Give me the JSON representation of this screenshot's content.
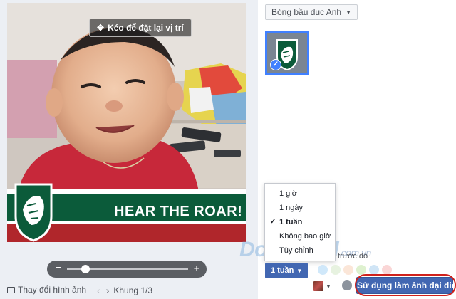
{
  "editor": {
    "drag_hint": "Kéo để đặt lại vị trí",
    "banner_text": "HEAR THE ROAR!",
    "zoom": {
      "level": 0.15,
      "minus_icon": "minus-icon",
      "plus_icon": "plus-icon"
    },
    "change_photo_label": "Thay đổi hình ảnh",
    "frame_counter": "Khung 1/3"
  },
  "frame_picker": {
    "selected_label": "Bóng bầu dục Anh",
    "thumbnail_icon": "leicester-tigers-logo",
    "thumbnail_selected": true
  },
  "duration": {
    "options": [
      {
        "label": "1 giờ",
        "selected": false
      },
      {
        "label": "1 ngày",
        "selected": false
      },
      {
        "label": "1 tuần",
        "selected": true
      },
      {
        "label": "Không bao giờ",
        "selected": false
      },
      {
        "label": "Tùy chỉnh",
        "selected": false
      }
    ],
    "button_label": "1 tuần",
    "trailing_text": "trước đó"
  },
  "watermark": {
    "text": "Download",
    "sub": ".com.vn"
  },
  "footer": {
    "primary_button": "Sử dụng làm ảnh đại diện"
  },
  "colors": {
    "accent": "#4267b2",
    "highlight_ring": "#d0211c",
    "banner_green": "#0b5b3a",
    "banner_red": "#b0262b"
  }
}
